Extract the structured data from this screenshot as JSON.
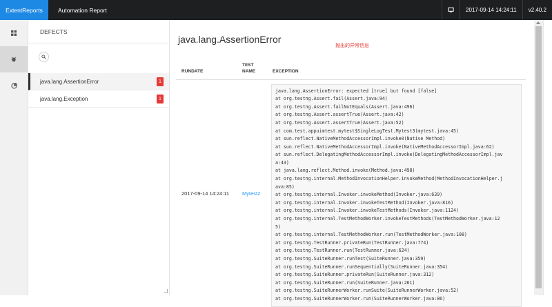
{
  "header": {
    "brand": "ExtentReports",
    "title": "Automation Report",
    "datetime": "2017-09-14 14:24:11",
    "version": "v2.40.2"
  },
  "nav": {
    "icons": [
      "dashboard-icon",
      "bug-icon",
      "pie-chart-icon"
    ],
    "active_index": 1
  },
  "panel": {
    "header": "DEFECTS",
    "items": [
      {
        "label": "java.lang.AssertionError",
        "count": "1"
      },
      {
        "label": "java.lang.Exception",
        "count": "1"
      }
    ]
  },
  "main": {
    "title": "java.lang.AssertionError",
    "annotation": "抛出的异常信息",
    "table": {
      "col_rundate": "RUNDATE",
      "col_testname": "TEST NAME",
      "col_exception": "EXCEPTION",
      "row": {
        "rundate": "2017-09-14 14:24:11",
        "testname": "Mytest2",
        "exception": "java.lang.AssertionError: expected [true] but found [false]\nat org.testng.Assert.fail(Assert.java:94)\nat org.testng.Assert.failNotEquals(Assert.java:496)\nat org.testng.Assert.assertTrue(Assert.java:42)\nat org.testng.Assert.assertTrue(Assert.java:52)\nat com.test.appuimtest.mytest$SingleLogTest.Mytest3(mytest.java:45)\nat sun.reflect.NativeMethodAccessorImpl.invoke0(Native Method)\nat sun.reflect.NativeMethodAccessorImpl.invoke(NativeMethodAccessorImpl.java:62)\nat sun.reflect.DelegatingMethodAccessorImpl.invoke(DelegatingMethodAccessorImpl.jav\na:43)\nat java.lang.reflect.Method.invoke(Method.java:498)\nat org.testng.internal.MethodInvocationHelper.invokeMethod(MethodInvocationHelper.j\nava:85)\nat org.testng.internal.Invoker.invokeMethod(Invoker.java:639)\nat org.testng.internal.Invoker.invokeTestMethod(Invoker.java:816)\nat org.testng.internal.Invoker.invokeTestMethods(Invoker.java:1124)\nat org.testng.internal.TestMethodWorker.invokeTestMethods(TestMethodWorker.java:12\n5)\nat org.testng.internal.TestMethodWorker.run(TestMethodWorker.java:108)\nat org.testng.TestRunner.privateRun(TestRunner.java:774)\nat org.testng.TestRunner.run(TestRunner.java:624)\nat org.testng.SuiteRunner.runTest(SuiteRunner.java:359)\nat org.testng.SuiteRunner.runSequentially(SuiteRunner.java:354)\nat org.testng.SuiteRunner.privateRun(SuiteRunner.java:312)\nat org.testng.SuiteRunner.run(SuiteRunner.java:261)\nat org.testng.SuiteRunnerWorker.runSuite(SuiteRunnerWorker.java:52)\nat org.testng.SuiteRunnerWorker.run(SuiteRunnerWorker.java:86)"
      }
    }
  },
  "colors": {
    "brand": "#1e88e5",
    "topbar": "#1e1f21",
    "badge": "#e53935",
    "link": "#2196f3",
    "annotation": "#e53935"
  }
}
